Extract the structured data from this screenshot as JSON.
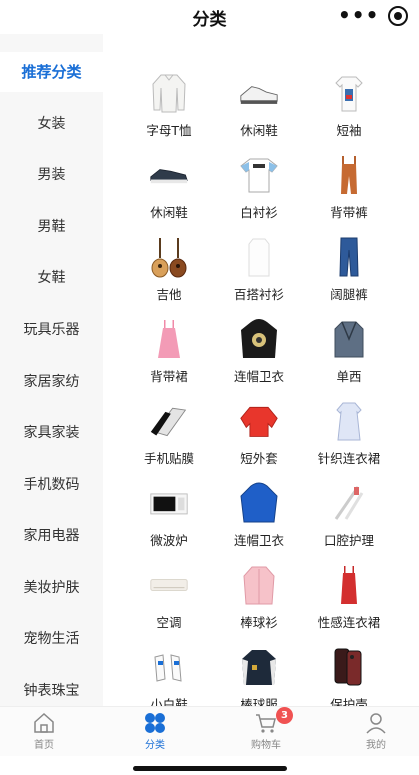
{
  "header": {
    "title": "分类"
  },
  "sidebar": {
    "items": [
      {
        "label": "推荐分类",
        "active": true
      },
      {
        "label": "女装"
      },
      {
        "label": "男装"
      },
      {
        "label": "男鞋"
      },
      {
        "label": "女鞋"
      },
      {
        "label": "玩具乐器"
      },
      {
        "label": "家居家纺"
      },
      {
        "label": "家具家装"
      },
      {
        "label": "手机数码"
      },
      {
        "label": "家用电器"
      },
      {
        "label": "美妆护肤"
      },
      {
        "label": "宠物生活"
      },
      {
        "label": "钟表珠宝"
      }
    ]
  },
  "grid": {
    "items": [
      {
        "label": "字母T恤",
        "icon": "white-longsleeve-shirt-icon"
      },
      {
        "label": "休闲鞋",
        "icon": "white-sneaker-icon"
      },
      {
        "label": "短袖",
        "icon": "printed-tshirt-icon"
      },
      {
        "label": "休闲鞋",
        "icon": "dark-loafer-icon"
      },
      {
        "label": "白衬衫",
        "icon": "white-tshirt-icon"
      },
      {
        "label": "背带裤",
        "icon": "overalls-icon"
      },
      {
        "label": "吉他",
        "icon": "guitar-icon"
      },
      {
        "label": "百搭衬衫",
        "icon": "white-blouse-icon"
      },
      {
        "label": "阔腿裤",
        "icon": "jeans-icon"
      },
      {
        "label": "背带裙",
        "icon": "pink-dress-icon"
      },
      {
        "label": "连帽卫衣",
        "icon": "black-hoodie-icon"
      },
      {
        "label": "单西",
        "icon": "blazer-icon"
      },
      {
        "label": "手机贴膜",
        "icon": "screen-protector-icon"
      },
      {
        "label": "短外套",
        "icon": "red-jacket-icon"
      },
      {
        "label": "针织连衣裙",
        "icon": "knit-dress-icon"
      },
      {
        "label": "微波炉",
        "icon": "microwave-icon"
      },
      {
        "label": "连帽卫衣",
        "icon": "blue-hoodie-icon"
      },
      {
        "label": "口腔护理",
        "icon": "toothbrush-icon"
      },
      {
        "label": "空调",
        "icon": "air-conditioner-icon"
      },
      {
        "label": "棒球衫",
        "icon": "pink-coat-icon"
      },
      {
        "label": "性感连衣裙",
        "icon": "red-dress-icon"
      },
      {
        "label": "小白鞋",
        "icon": "white-shoes-icon"
      },
      {
        "label": "棒球服",
        "icon": "varsity-jacket-icon"
      },
      {
        "label": "保护壳",
        "icon": "phone-case-icon"
      }
    ]
  },
  "tabbar": {
    "tabs": [
      {
        "label": "首页",
        "icon": "home-icon"
      },
      {
        "label": "分类",
        "icon": "category-icon",
        "active": true
      },
      {
        "label": "购物车",
        "icon": "cart-icon",
        "badge": "3"
      },
      {
        "label": "我的",
        "icon": "user-icon"
      }
    ]
  },
  "colors": {
    "accent": "#1a6fd6",
    "badge": "#f05252",
    "sidebar_bg": "#f7f7f7"
  }
}
